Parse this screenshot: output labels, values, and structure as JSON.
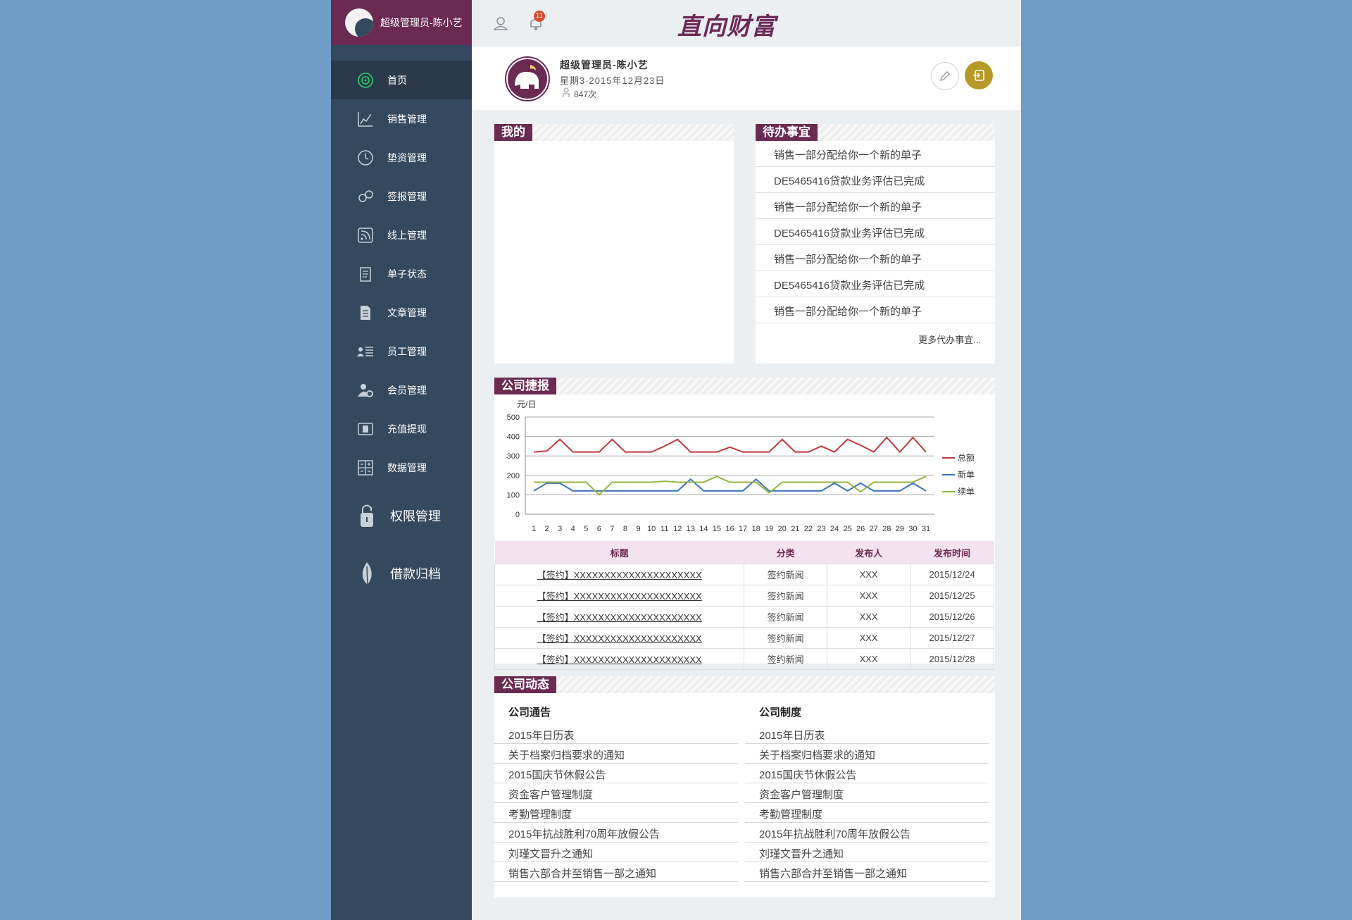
{
  "sidebar": {
    "user_label": "超级管理员-陈小艺",
    "items": [
      {
        "label": "首页",
        "icon": "target-icon",
        "active": true
      },
      {
        "label": "销售管理",
        "icon": "chart-icon"
      },
      {
        "label": "垫资管理",
        "icon": "clock-icon"
      },
      {
        "label": "签报管理",
        "icon": "link-icon"
      },
      {
        "label": "线上管理",
        "icon": "rss-icon"
      },
      {
        "label": "单子状态",
        "icon": "notepad-icon"
      },
      {
        "label": "文章管理",
        "icon": "document-icon"
      },
      {
        "label": "员工管理",
        "icon": "staff-list-icon"
      },
      {
        "label": "会员管理",
        "icon": "member-gear-icon"
      },
      {
        "label": "充值提现",
        "icon": "wallet-icon"
      },
      {
        "label": "数据管理",
        "icon": "calculator-icon"
      },
      {
        "label": "权限管理",
        "icon": "lock-icon",
        "big": true
      },
      {
        "label": "借款归档",
        "icon": "leaf-icon",
        "big": true
      }
    ]
  },
  "topbar": {
    "logo_text": "直向财富",
    "notification_count": "11"
  },
  "profile": {
    "name": "超级管理员-陈小艺",
    "date": "星期3·2015年12月23日",
    "visits": "847次"
  },
  "panels": {
    "mine_title": "我的",
    "todo_title": "待办事宜",
    "todo_items": [
      "销售一部分配给你一个新的单子",
      "DE5465416贷款业务评估已完成",
      "销售一部分配给你一个新的单子",
      "DE5465416贷款业务评估已完成",
      "销售一部分配给你一个新的单子",
      "DE5465416贷款业务评估已完成",
      "销售一部分配给你一个新的单子"
    ],
    "todo_more": "更多代办事宜...",
    "report_title": "公司捷报",
    "dynamics_title": "公司动态"
  },
  "chart_data": {
    "type": "line",
    "ylabel": "元/日",
    "ylim": [
      0,
      500
    ],
    "yticks": [
      0,
      100,
      200,
      300,
      400,
      500
    ],
    "x": [
      1,
      2,
      3,
      4,
      5,
      6,
      7,
      8,
      9,
      10,
      11,
      12,
      13,
      14,
      15,
      16,
      17,
      18,
      19,
      20,
      21,
      22,
      23,
      24,
      25,
      26,
      27,
      28,
      29,
      30,
      31
    ],
    "series": [
      {
        "name": "总额",
        "color": "#c0393d",
        "values": [
          320,
          325,
          385,
          320,
          320,
          320,
          385,
          320,
          320,
          320,
          350,
          385,
          320,
          320,
          320,
          345,
          320,
          320,
          320,
          385,
          320,
          320,
          350,
          320,
          385,
          355,
          320,
          395,
          320,
          395,
          320
        ]
      },
      {
        "name": "新单",
        "color": "#3b74b8",
        "values": [
          120,
          160,
          160,
          120,
          120,
          120,
          120,
          120,
          120,
          120,
          120,
          120,
          180,
          120,
          120,
          120,
          120,
          180,
          120,
          120,
          120,
          120,
          120,
          160,
          120,
          160,
          120,
          120,
          120,
          160,
          120
        ]
      },
      {
        "name": "续单",
        "color": "#94b540",
        "values": [
          165,
          165,
          165,
          165,
          165,
          100,
          165,
          165,
          165,
          165,
          170,
          165,
          165,
          165,
          195,
          165,
          165,
          165,
          110,
          165,
          165,
          165,
          165,
          165,
          165,
          115,
          165,
          165,
          165,
          165,
          195
        ]
      }
    ],
    "legend": "right",
    "grid": true
  },
  "news_table": {
    "headers": [
      "标题",
      "分类",
      "发布人",
      "发布时间"
    ],
    "rows": [
      [
        "【签约】XXXXXXXXXXXXXXXXXXXXX",
        "签约新闻",
        "XXX",
        "2015/12/24"
      ],
      [
        "【签约】XXXXXXXXXXXXXXXXXXXXX",
        "签约新闻",
        "XXX",
        "2015/12/25"
      ],
      [
        "【签约】XXXXXXXXXXXXXXXXXXXXX",
        "签约新闻",
        "XXX",
        "2015/12/26"
      ],
      [
        "【签约】XXXXXXXXXXXXXXXXXXXXX",
        "签约新闻",
        "XXX",
        "2015/12/27"
      ],
      [
        "【签约】XXXXXXXXXXXXXXXXXXXXX",
        "签约新闻",
        "XXX",
        "2015/12/28"
      ]
    ]
  },
  "dynamics": {
    "notices_title": "公司通告",
    "rules_title": "公司制度",
    "notices": [
      "2015年日历表",
      "关于档案归档要求的通知",
      "2015国庆节休假公告",
      "资金客户管理制度",
      "考勤管理制度",
      "2015年抗战胜利70周年放假公告",
      "刘瑾文晋升之通知",
      "销售六部合并至销售一部之通知"
    ],
    "rules": [
      "2015年日历表",
      "关于档案归档要求的通知",
      "2015国庆节休假公告",
      "资金客户管理制度",
      "考勤管理制度",
      "2015年抗战胜利70周年放假公告",
      "刘瑾文晋升之通知",
      "销售六部合并至销售一部之通知"
    ]
  }
}
